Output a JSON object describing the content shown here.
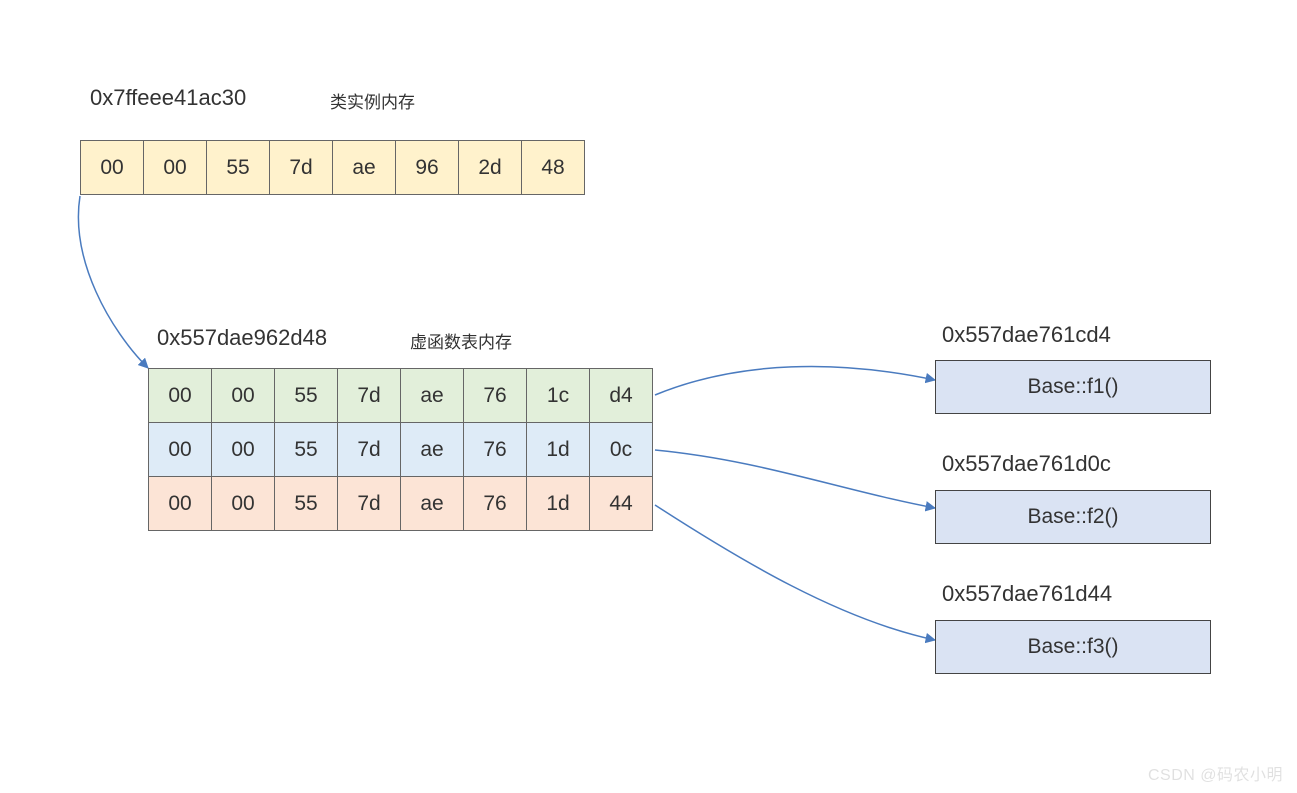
{
  "instance": {
    "address": "0x7ffeee41ac30",
    "label": "类实例内存",
    "bytes": [
      "00",
      "00",
      "55",
      "7d",
      "ae",
      "96",
      "2d",
      "48"
    ]
  },
  "vtable": {
    "address": "0x557dae962d48",
    "label": "虚函数表内存",
    "rows": [
      {
        "bytes": [
          "00",
          "00",
          "55",
          "7d",
          "ae",
          "76",
          "1c",
          "d4"
        ]
      },
      {
        "bytes": [
          "00",
          "00",
          "55",
          "7d",
          "ae",
          "76",
          "1d",
          "0c"
        ]
      },
      {
        "bytes": [
          "00",
          "00",
          "55",
          "7d",
          "ae",
          "76",
          "1d",
          "44"
        ]
      }
    ]
  },
  "functions": [
    {
      "address": "0x557dae761cd4",
      "name": "Base::f1()"
    },
    {
      "address": "0x557dae761d0c",
      "name": "Base::f2()"
    },
    {
      "address": "0x557dae761d44",
      "name": "Base::f3()"
    }
  ],
  "watermark": "CSDN @码农小明"
}
